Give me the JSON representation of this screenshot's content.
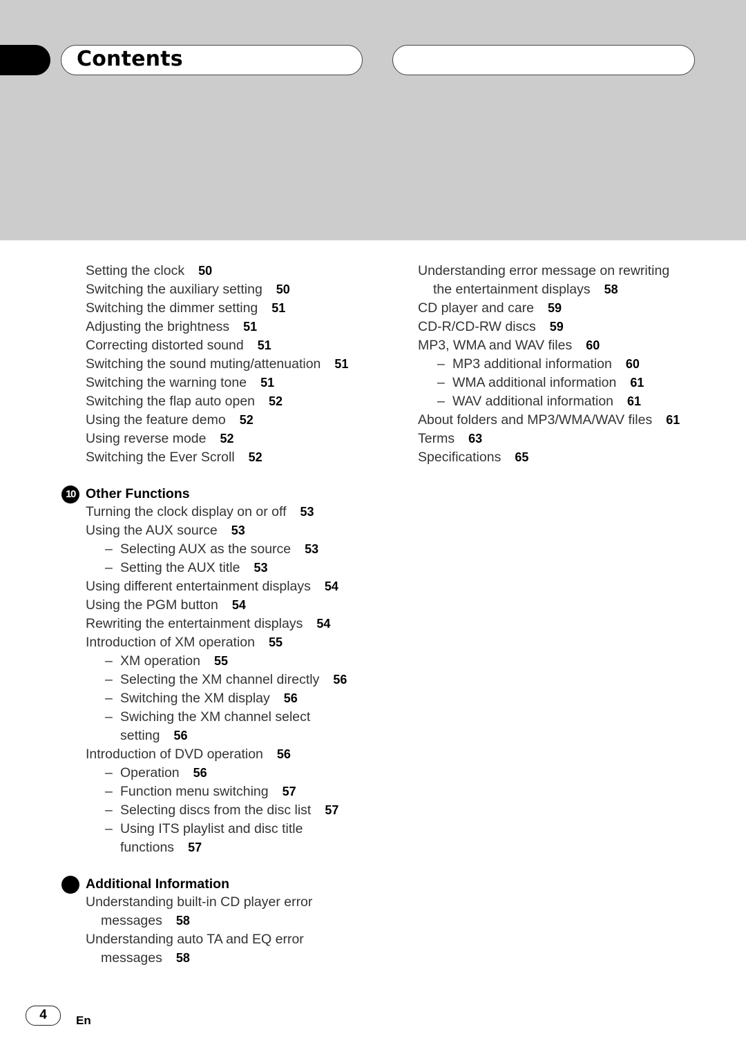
{
  "header": {
    "title": "Contents"
  },
  "left_column": {
    "entries": [
      {
        "text": "Setting the clock",
        "page": "50"
      },
      {
        "text": "Switching the auxiliary setting",
        "page": "50"
      },
      {
        "text": "Switching the dimmer setting",
        "page": "51"
      },
      {
        "text": "Adjusting the brightness",
        "page": "51"
      },
      {
        "text": "Correcting distorted sound",
        "page": "51"
      },
      {
        "text": "Switching the sound muting/attenuation",
        "page": "51"
      },
      {
        "text": "Switching the warning tone",
        "page": "51"
      },
      {
        "text": "Switching the flap auto open",
        "page": "52"
      },
      {
        "text": "Using the feature demo",
        "page": "52"
      },
      {
        "text": "Using reverse mode",
        "page": "52"
      },
      {
        "text": "Switching the Ever Scroll",
        "page": "52"
      }
    ],
    "section_other": {
      "number": "10",
      "title": "Other Functions",
      "entries": [
        {
          "text": "Turning the clock display on or off",
          "page": "53"
        },
        {
          "text": "Using the AUX source",
          "page": "53"
        },
        {
          "text": "Selecting AUX as the source",
          "page": "53",
          "dash": "–"
        },
        {
          "text": "Setting the AUX title",
          "page": "53",
          "dash": "–"
        },
        {
          "text": "Using different entertainment displays",
          "page": "54"
        },
        {
          "text": "Using the PGM button",
          "page": "54"
        },
        {
          "text": "Rewriting the entertainment displays",
          "page": "54"
        },
        {
          "text": "Introduction of XM operation",
          "page": "55"
        },
        {
          "text": "XM operation",
          "page": "55",
          "dash": "–"
        },
        {
          "text": "Selecting the XM channel directly",
          "page": "56",
          "dash": "–"
        },
        {
          "text": "Switching the XM display",
          "page": "56",
          "dash": "–"
        },
        {
          "text": "Swiching the XM channel select",
          "text2": "setting",
          "page": "56",
          "dash": "–"
        },
        {
          "text": "Introduction of DVD operation",
          "page": "56"
        },
        {
          "text": "Operation",
          "page": "56",
          "dash": "–"
        },
        {
          "text": "Function menu switching",
          "page": "57",
          "dash": "–"
        },
        {
          "text": "Selecting discs from the disc list",
          "page": "57",
          "dash": "–"
        },
        {
          "text": "Using ITS playlist and disc title",
          "text2": "functions",
          "page": "57",
          "dash": "–"
        }
      ]
    },
    "section_additional": {
      "title": "Additional Information",
      "entries": [
        {
          "text": "Understanding built-in CD player error",
          "text2": "messages",
          "page": "58"
        },
        {
          "text": "Understanding auto TA and EQ error",
          "text2": "messages",
          "page": "58"
        }
      ]
    }
  },
  "right_column": {
    "entries": [
      {
        "text": "Understanding error message on rewriting",
        "text2": "the entertainment displays",
        "page": "58"
      },
      {
        "text": "CD player and care",
        "page": "59"
      },
      {
        "text": "CD-R/CD-RW discs",
        "page": "59"
      },
      {
        "text": "MP3, WMA and WAV files",
        "page": "60"
      },
      {
        "text": "MP3 additional information",
        "page": "60",
        "dash": "–"
      },
      {
        "text": "WMA additional information",
        "page": "61",
        "dash": "–"
      },
      {
        "text": "WAV additional information",
        "page": "61",
        "dash": "–"
      },
      {
        "text": "About folders and MP3/WMA/WAV files",
        "page": "61"
      },
      {
        "text": "Terms",
        "page": "63"
      },
      {
        "text": "Specifications",
        "page": "65"
      }
    ]
  },
  "footer": {
    "page_number": "4",
    "language": "En"
  }
}
